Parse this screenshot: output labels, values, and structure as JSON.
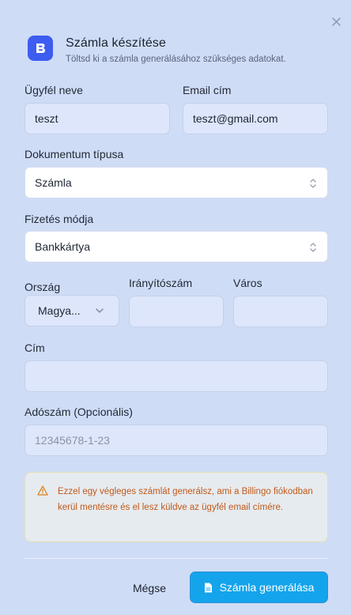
{
  "dialog": {
    "title": "Számla készítése",
    "subtitle": "Töltsd ki a számla generálásához szükséges adatokat."
  },
  "form": {
    "customer_name": {
      "label": "Ügyfél neve",
      "value": "teszt"
    },
    "email": {
      "label": "Email cím",
      "value": "teszt@gmail.com"
    },
    "document_type": {
      "label": "Dokumentum típusa",
      "value": "Számla"
    },
    "payment_method": {
      "label": "Fizetés módja",
      "value": "Bankkártya"
    },
    "country": {
      "label": "Ország",
      "value": "Magya..."
    },
    "postal_code": {
      "label": "Irányítószám",
      "value": ""
    },
    "city": {
      "label": "Város",
      "value": ""
    },
    "address": {
      "label": "Cím",
      "value": ""
    },
    "tax_number": {
      "label": "Adószám (Opcionális)",
      "value": "",
      "placeholder": "12345678-1-23"
    }
  },
  "alert": {
    "text": "Ezzel egy végleges számlát generálsz, ami a Billingo fiókodban kerül mentésre és el lesz küldve az ügyfél email címére."
  },
  "footer": {
    "cancel_label": "Mégse",
    "submit_label": "Számla generálása"
  },
  "colors": {
    "background": "#cfdcf6",
    "accent": "#14a4ec",
    "logo": "#3d5cf0",
    "warning": "#c15a1a"
  },
  "icons": {
    "close": "close-icon",
    "logo": "billingo-logo-icon",
    "select": "chevron-up-down-icon",
    "dropdown": "chevron-down-icon",
    "warning": "warning-triangle-icon",
    "document": "document-icon"
  }
}
